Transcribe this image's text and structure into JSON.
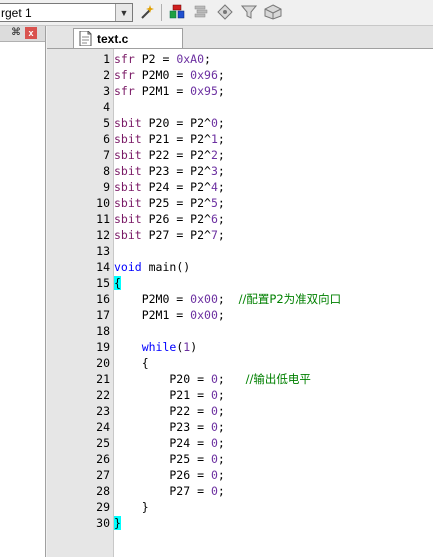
{
  "toolbar": {
    "target": "rget 1",
    "icons": [
      "dropdown-arrow",
      "magic-wand",
      "stack-red-green",
      "stack-gray",
      "diamond-settings",
      "funnel",
      "cube-manage"
    ]
  },
  "left_panel": {
    "pin_glyph": "⬠",
    "close_glyph": "x"
  },
  "tab": {
    "label": "text.c"
  },
  "code_lines": [
    {
      "n": "1",
      "parts": [
        {
          "t": "sfr",
          "c": "kw"
        },
        {
          "t": " P2 = "
        },
        {
          "t": "0xA0",
          "c": "num"
        },
        {
          "t": ";"
        }
      ]
    },
    {
      "n": "2",
      "parts": [
        {
          "t": "sfr",
          "c": "kw"
        },
        {
          "t": " P2M0 = "
        },
        {
          "t": "0x96",
          "c": "num"
        },
        {
          "t": ";"
        }
      ]
    },
    {
      "n": "3",
      "parts": [
        {
          "t": "sfr",
          "c": "kw"
        },
        {
          "t": " P2M1 = "
        },
        {
          "t": "0x95",
          "c": "num"
        },
        {
          "t": ";"
        }
      ]
    },
    {
      "n": "4",
      "parts": []
    },
    {
      "n": "5",
      "parts": [
        {
          "t": "sbit",
          "c": "kw"
        },
        {
          "t": " P20 = P2^"
        },
        {
          "t": "0",
          "c": "num"
        },
        {
          "t": ";"
        }
      ]
    },
    {
      "n": "6",
      "parts": [
        {
          "t": "sbit",
          "c": "kw"
        },
        {
          "t": " P21 = P2^"
        },
        {
          "t": "1",
          "c": "num"
        },
        {
          "t": ";"
        }
      ]
    },
    {
      "n": "7",
      "parts": [
        {
          "t": "sbit",
          "c": "kw"
        },
        {
          "t": " P22 = P2^"
        },
        {
          "t": "2",
          "c": "num"
        },
        {
          "t": ";"
        }
      ]
    },
    {
      "n": "8",
      "parts": [
        {
          "t": "sbit",
          "c": "kw"
        },
        {
          "t": " P23 = P2^"
        },
        {
          "t": "3",
          "c": "num"
        },
        {
          "t": ";"
        }
      ]
    },
    {
      "n": "9",
      "parts": [
        {
          "t": "sbit",
          "c": "kw"
        },
        {
          "t": " P24 = P2^"
        },
        {
          "t": "4",
          "c": "num"
        },
        {
          "t": ";"
        }
      ]
    },
    {
      "n": "10",
      "parts": [
        {
          "t": "sbit",
          "c": "kw"
        },
        {
          "t": " P25 = P2^"
        },
        {
          "t": "5",
          "c": "num"
        },
        {
          "t": ";"
        }
      ]
    },
    {
      "n": "11",
      "parts": [
        {
          "t": "sbit",
          "c": "kw"
        },
        {
          "t": " P26 = P2^"
        },
        {
          "t": "6",
          "c": "num"
        },
        {
          "t": ";"
        }
      ]
    },
    {
      "n": "12",
      "parts": [
        {
          "t": "sbit",
          "c": "kw"
        },
        {
          "t": " P27 = P2^"
        },
        {
          "t": "7",
          "c": "num"
        },
        {
          "t": ";"
        }
      ]
    },
    {
      "n": "13",
      "parts": []
    },
    {
      "n": "14",
      "parts": [
        {
          "t": "void",
          "c": "kb"
        },
        {
          "t": " main()"
        }
      ]
    },
    {
      "n": "15",
      "parts": [
        {
          "t": "{",
          "c": "br"
        }
      ]
    },
    {
      "n": "16",
      "parts": [
        {
          "t": "    P2M0 = "
        },
        {
          "t": "0x00",
          "c": "num"
        },
        {
          "t": ";  "
        },
        {
          "t": "//配置P2为准双向口",
          "c": "cmt"
        }
      ]
    },
    {
      "n": "17",
      "parts": [
        {
          "t": "    P2M1 = "
        },
        {
          "t": "0x00",
          "c": "num"
        },
        {
          "t": ";"
        }
      ]
    },
    {
      "n": "18",
      "parts": []
    },
    {
      "n": "19",
      "parts": [
        {
          "t": "    "
        },
        {
          "t": "while",
          "c": "kb"
        },
        {
          "t": "("
        },
        {
          "t": "1",
          "c": "num"
        },
        {
          "t": ")"
        }
      ]
    },
    {
      "n": "20",
      "parts": [
        {
          "t": "    {"
        }
      ]
    },
    {
      "n": "21",
      "parts": [
        {
          "t": "        P20 = "
        },
        {
          "t": "0",
          "c": "num"
        },
        {
          "t": ";   "
        },
        {
          "t": "//输出低电平",
          "c": "cmt"
        }
      ]
    },
    {
      "n": "22",
      "parts": [
        {
          "t": "        P21 = "
        },
        {
          "t": "0",
          "c": "num"
        },
        {
          "t": ";"
        }
      ]
    },
    {
      "n": "23",
      "parts": [
        {
          "t": "        P22 = "
        },
        {
          "t": "0",
          "c": "num"
        },
        {
          "t": ";"
        }
      ]
    },
    {
      "n": "24",
      "parts": [
        {
          "t": "        P23 = "
        },
        {
          "t": "0",
          "c": "num"
        },
        {
          "t": ";"
        }
      ]
    },
    {
      "n": "25",
      "parts": [
        {
          "t": "        P24 = "
        },
        {
          "t": "0",
          "c": "num"
        },
        {
          "t": ";"
        }
      ]
    },
    {
      "n": "26",
      "parts": [
        {
          "t": "        P25 = "
        },
        {
          "t": "0",
          "c": "num"
        },
        {
          "t": ";"
        }
      ]
    },
    {
      "n": "27",
      "parts": [
        {
          "t": "        P26 = "
        },
        {
          "t": "0",
          "c": "num"
        },
        {
          "t": ";"
        }
      ]
    },
    {
      "n": "28",
      "parts": [
        {
          "t": "        P27 = "
        },
        {
          "t": "0",
          "c": "num"
        },
        {
          "t": ";"
        }
      ]
    },
    {
      "n": "29",
      "parts": [
        {
          "t": "    }"
        }
      ]
    },
    {
      "n": "30",
      "parts": [
        {
          "t": "}",
          "c": "br"
        }
      ]
    }
  ]
}
